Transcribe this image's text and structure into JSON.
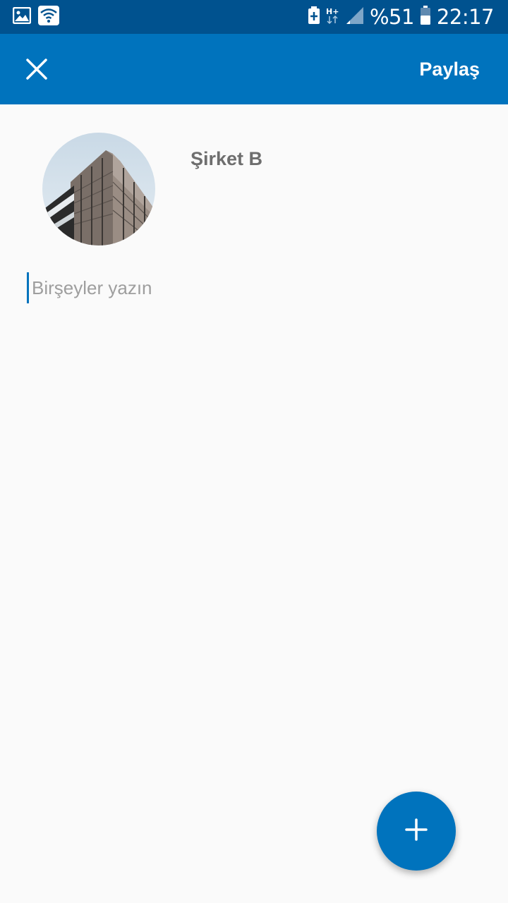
{
  "status_bar": {
    "icons_left": [
      "image-icon",
      "wifi-icon"
    ],
    "icons_right": [
      "battery-saver-icon",
      "network-hplus-icon",
      "signal-icon",
      "battery-icon"
    ],
    "battery_percent": "%51",
    "time": "22:17"
  },
  "app_bar": {
    "close_icon": "close-icon",
    "share_label": "Paylaş",
    "background": "#0073bd"
  },
  "post": {
    "company_name": "Şirket B",
    "input_placeholder": "Birşeyler yazın",
    "input_value": ""
  },
  "fab": {
    "icon": "plus-icon",
    "color": "#0073bd"
  }
}
